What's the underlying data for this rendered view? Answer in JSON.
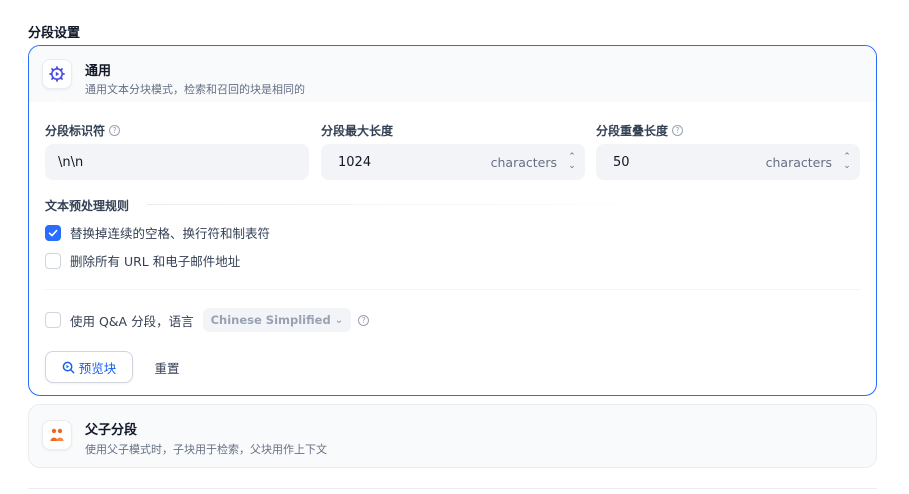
{
  "section_title": "分段设置",
  "colors": {
    "accent": "#296dff",
    "parent_icon": "#ef6820"
  },
  "general": {
    "icon": "gear-play-icon",
    "title": "通用",
    "description": "通用文本分块模式，检索和召回的块是相同的",
    "fields": {
      "separator": {
        "label": "分段标识符",
        "value": "\\n\\n",
        "help_icon": "question-circle-icon"
      },
      "max_length": {
        "label": "分段最大长度",
        "value": "1024",
        "suffix": "characters"
      },
      "overlap": {
        "label": "分段重叠长度",
        "value": "50",
        "suffix": "characters",
        "help_icon": "question-circle-icon"
      }
    },
    "rules_title": "文本预处理规则",
    "rules": [
      {
        "label": "替换掉连续的空格、换行符和制表符",
        "checked": true
      },
      {
        "label": "删除所有 URL 和电子邮件地址",
        "checked": false
      }
    ],
    "qa": {
      "label": "使用 Q&A 分段，语言",
      "language": "Chinese Simplified",
      "checked": false
    },
    "preview_button": "预览块",
    "reset_button": "重置"
  },
  "parent_child": {
    "icon": "parent-child-icon",
    "title": "父子分段",
    "description": "使用父子模式时，子块用于检索，父块用作上下文"
  }
}
